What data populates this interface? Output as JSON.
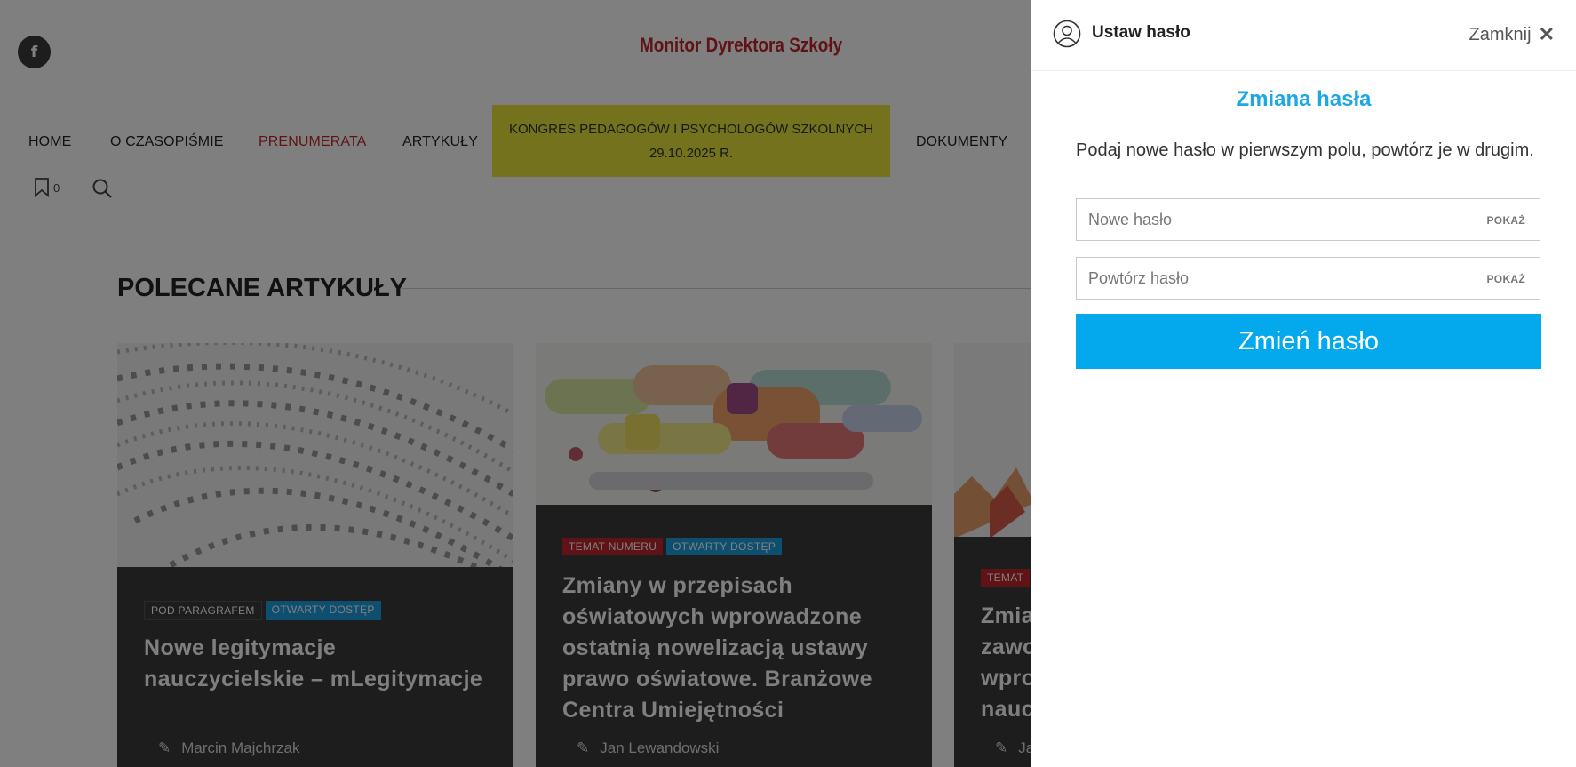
{
  "site": {
    "logo_text": "Monitor Dyrektora Szkoły",
    "facebook_icon": "f",
    "nav": [
      {
        "label": "HOME"
      },
      {
        "label": "O CZASOPIŚMIE"
      },
      {
        "label": "PRENUMERATA",
        "highlight": "red"
      },
      {
        "label": "ARTYKUŁY"
      },
      {
        "label": "KONGRES PEDAGOGÓW I PSYCHOLOGÓW SZKOLNYCH 29.10.2025 R.",
        "highlight": "yellow"
      },
      {
        "label": "DOKUMENTY"
      }
    ],
    "bookmark_count": "0",
    "section_title": "POLECANE ARTYKUŁY",
    "cards": [
      {
        "badges": [
          "POD PARAGRAFEM",
          "OTWARTY DOSTĘP"
        ],
        "title": "Nowe legitymacje nauczycielskie – mLegitymacje",
        "author": "Marcin Majchrzak"
      },
      {
        "badges": [
          "TEMAT NUMERU",
          "OTWARTY DOSTĘP"
        ],
        "title": "Zmiany w przepisach oświatowych wprowadzone ostatnią nowelizacją ustawy prawo oświatowe. Branżowe Centra Umiejętności",
        "author": "Jan Lewandowski"
      },
      {
        "badges": [
          "TEMAT"
        ],
        "title_lines": [
          "Zmia",
          "zawo",
          "wpro",
          "nauc"
        ],
        "author": "Ja"
      }
    ]
  },
  "drawer": {
    "title": "Ustaw hasło",
    "close_label": "Zamknij",
    "heading": "Zmiana hasła",
    "description": "Podaj nowe hasło w pierwszym polu, powtórz je w drugim.",
    "new_password_placeholder": "Nowe hasło",
    "repeat_password_placeholder": "Powtórz hasło",
    "show_label": "POKAŻ",
    "submit_label": "Zmień hasło"
  },
  "colors": {
    "accent_blue": "#03a8ed",
    "heading_blue": "#1da7e4",
    "brand_red": "#c0272d",
    "kongres_yellow": "#e8e43a",
    "overlay": "rgba(0,0,0,0.5)"
  }
}
